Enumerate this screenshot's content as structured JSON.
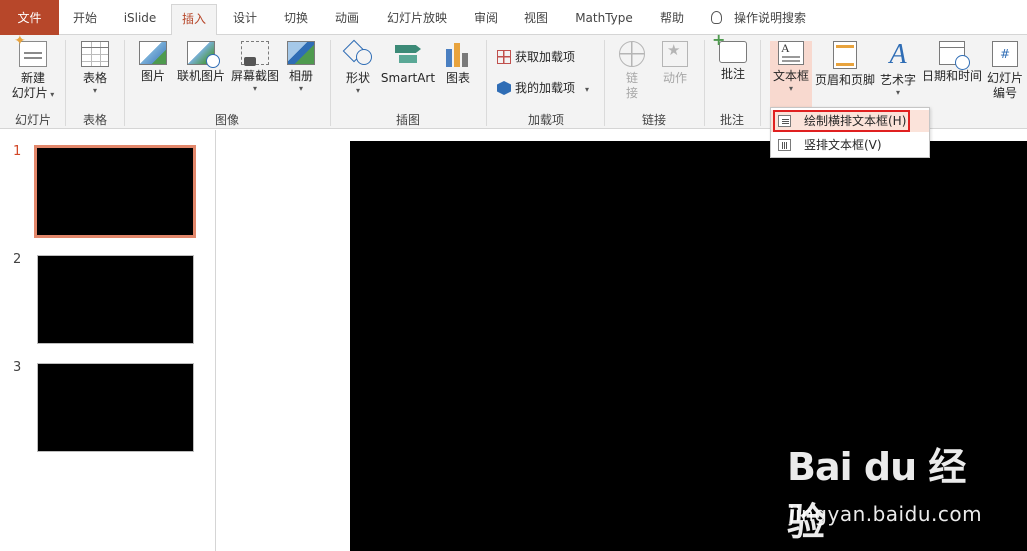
{
  "tabs": [
    "文件",
    "开始",
    "iSlide",
    "插入",
    "设计",
    "切换",
    "动画",
    "幻灯片放映",
    "审阅",
    "视图",
    "MathType",
    "帮助"
  ],
  "active_tab": "插入",
  "tell_me": "操作说明搜索",
  "ribbon": {
    "slides": {
      "new_slide": "新建",
      "new_slide_2": "幻灯片",
      "group": "幻灯片"
    },
    "tables": {
      "table": "表格",
      "group": "表格"
    },
    "images": {
      "picture": "图片",
      "online_picture": "联机图片",
      "screenshot": "屏幕截图",
      "album": "相册",
      "group": "图像"
    },
    "illustrations": {
      "shapes": "形状",
      "smartart": "SmartArt",
      "chart": "图表",
      "group": "插图"
    },
    "addins": {
      "get_addins": "获取加载项",
      "my_addins": "我的加载项",
      "group": "加载项"
    },
    "links": {
      "link": "链",
      "link_2": "接",
      "action": "动作",
      "group": "链接"
    },
    "comments": {
      "comment": "批注",
      "group": "批注"
    },
    "text": {
      "textbox": "文本框",
      "header_footer": "页眉和页脚",
      "wordart": "艺术字",
      "datetime": "日期和时间",
      "slide_number": "幻灯片",
      "slide_number_2": "编号",
      "textbox_icon_letter": "A",
      "wordart_icon_letter": "A",
      "slide_number_icon_glyph": "#"
    }
  },
  "textbox_menu": {
    "items": [
      "绘制横排文本框(H)",
      "竖排文本框(V)"
    ],
    "selected": "绘制横排文本框(H)"
  },
  "slides": [
    {
      "number": "1",
      "active": true
    },
    {
      "number": "2",
      "active": false
    },
    {
      "number": "3",
      "active": false
    }
  ],
  "watermark": {
    "logo": "Bai du 经验",
    "url": "jingyan.baidu.com"
  },
  "colors": {
    "file_tab": "#b7472a",
    "accent": "#b7472a",
    "highlight_box": "#e02020",
    "thumb_active_border": "#e2876b",
    "ribbon_bg": "#f3f3f3"
  }
}
